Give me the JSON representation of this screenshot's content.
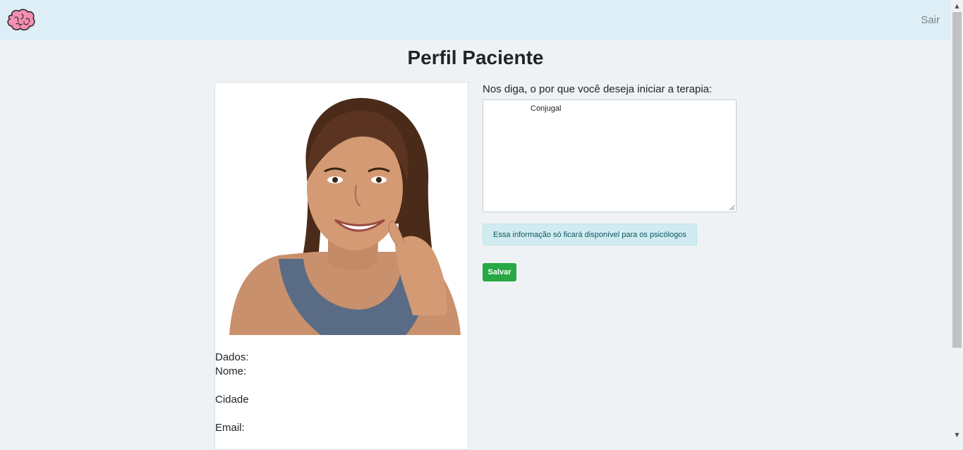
{
  "navbar": {
    "logo_icon": "brain-icon",
    "logout_label": "Sair"
  },
  "page": {
    "title": "Perfil Paciente"
  },
  "profile": {
    "photo_description_icon": "patient-photo",
    "data_heading": "Dados:",
    "name_label": "Nome:",
    "city_label": "Cidade",
    "email_label": "Email:"
  },
  "therapy": {
    "question_label": "Nos diga, o por que você deseja iniciar a terapia:",
    "reason_value": "Conjugal",
    "info_text": "Essa informação só ficará disponível para os psicólogos",
    "save_label": "Salvar"
  },
  "colors": {
    "navbar_bg": "#deeef6",
    "page_bg": "#eff2f5",
    "alert_bg": "#d1ecf1",
    "alert_text": "#0c5460",
    "save_button": "#28a745",
    "logo_pink": "#f48fb1"
  }
}
